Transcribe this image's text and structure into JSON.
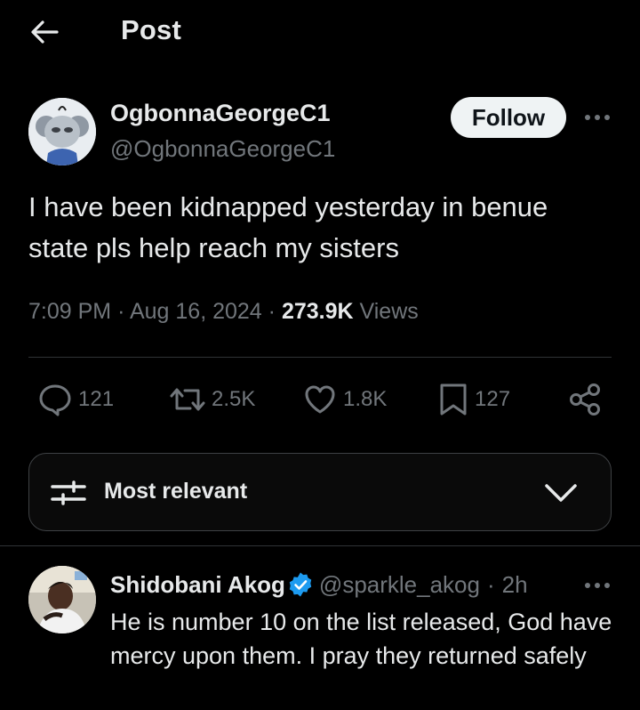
{
  "header": {
    "title": "Post"
  },
  "author": {
    "name": "OgbonnaGeorgeC1",
    "handle": "@OgbonnaGeorgeC1",
    "follow_label": "Follow"
  },
  "post": {
    "text": "I have been kidnapped yesterday in benue state pls help reach my sisters",
    "time": "7:09 PM",
    "date": "Aug 16, 2024",
    "views_count": "273.9K",
    "views_label": "Views"
  },
  "actions": {
    "replies": "121",
    "reposts": "2.5K",
    "likes": "1.8K",
    "bookmarks": "127"
  },
  "sort": {
    "label": "Most relevant"
  },
  "reply": {
    "name": "Shidobani Akog",
    "handle": "@sparkle_akog",
    "time": "2h",
    "text": "He is number 10 on the list released, God have mercy upon them. I pray they returned safely"
  },
  "colors": {
    "background": "#000000",
    "text_primary": "#e7e9ea",
    "text_secondary": "#71767b",
    "divider": "#2f3336",
    "follow_button": "#eff3f4",
    "verified": "#1d9bf0"
  },
  "icons": [
    "back-arrow-icon",
    "more-icon",
    "reply-icon",
    "repost-icon",
    "like-icon",
    "bookmark-icon",
    "share-icon",
    "sort-icon",
    "chevron-down-icon",
    "verified-icon"
  ]
}
